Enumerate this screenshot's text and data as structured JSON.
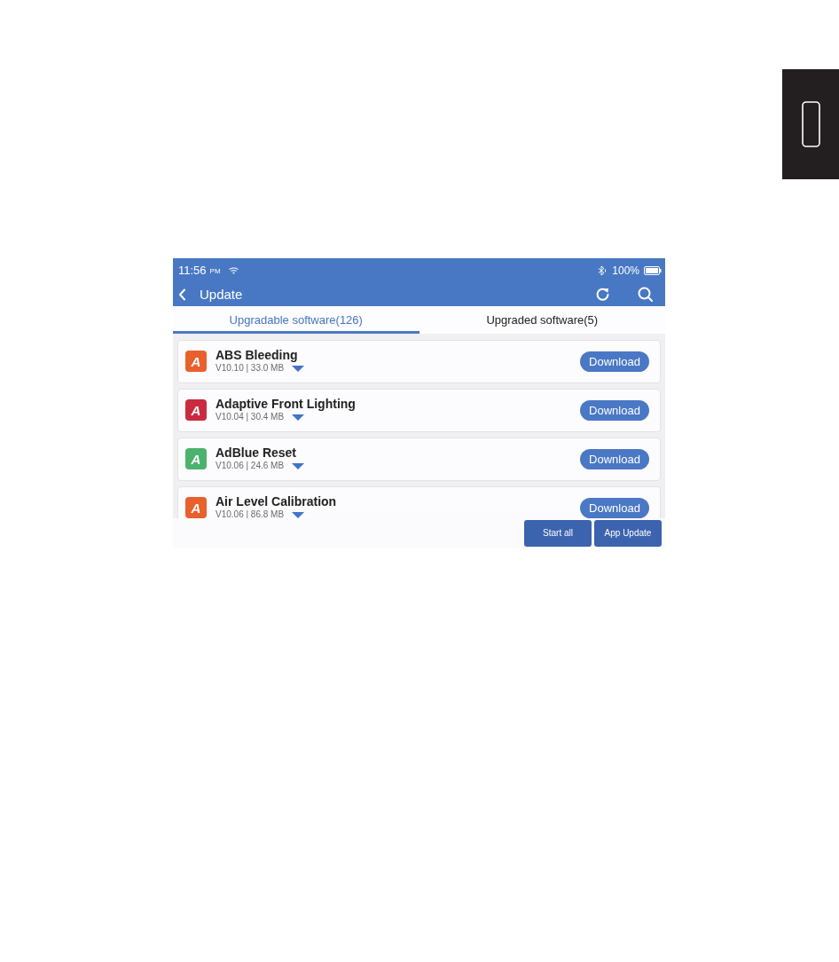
{
  "status_bar": {
    "time": "11:56",
    "meridiem": "PM",
    "battery": "100%"
  },
  "header": {
    "title": "Update"
  },
  "tabs": [
    {
      "label": "Upgradable software(126)",
      "selected": true
    },
    {
      "label": "Upgraded software(5)",
      "selected": false
    }
  ],
  "apps": [
    {
      "icon_letter": "A",
      "color": "#e8612d",
      "name": "ABS Bleeding",
      "details": "V10.10 | 33.0 MB",
      "action": "Download"
    },
    {
      "icon_letter": "A",
      "color": "#c92a3f",
      "name": "Adaptive Front Lighting",
      "details": "V10.04 | 30.4 MB",
      "action": "Download"
    },
    {
      "icon_letter": "A",
      "color": "#4cb26d",
      "name": "AdBlue Reset",
      "details": "V10.06 | 24.6 MB",
      "action": "Download"
    },
    {
      "icon_letter": "A",
      "color": "#e8612d",
      "name": "Air Level Calibration",
      "details": "V10.06 | 86.8 MB",
      "action": "Download"
    }
  ],
  "footer_buttons": [
    "Start all",
    "App Update"
  ]
}
